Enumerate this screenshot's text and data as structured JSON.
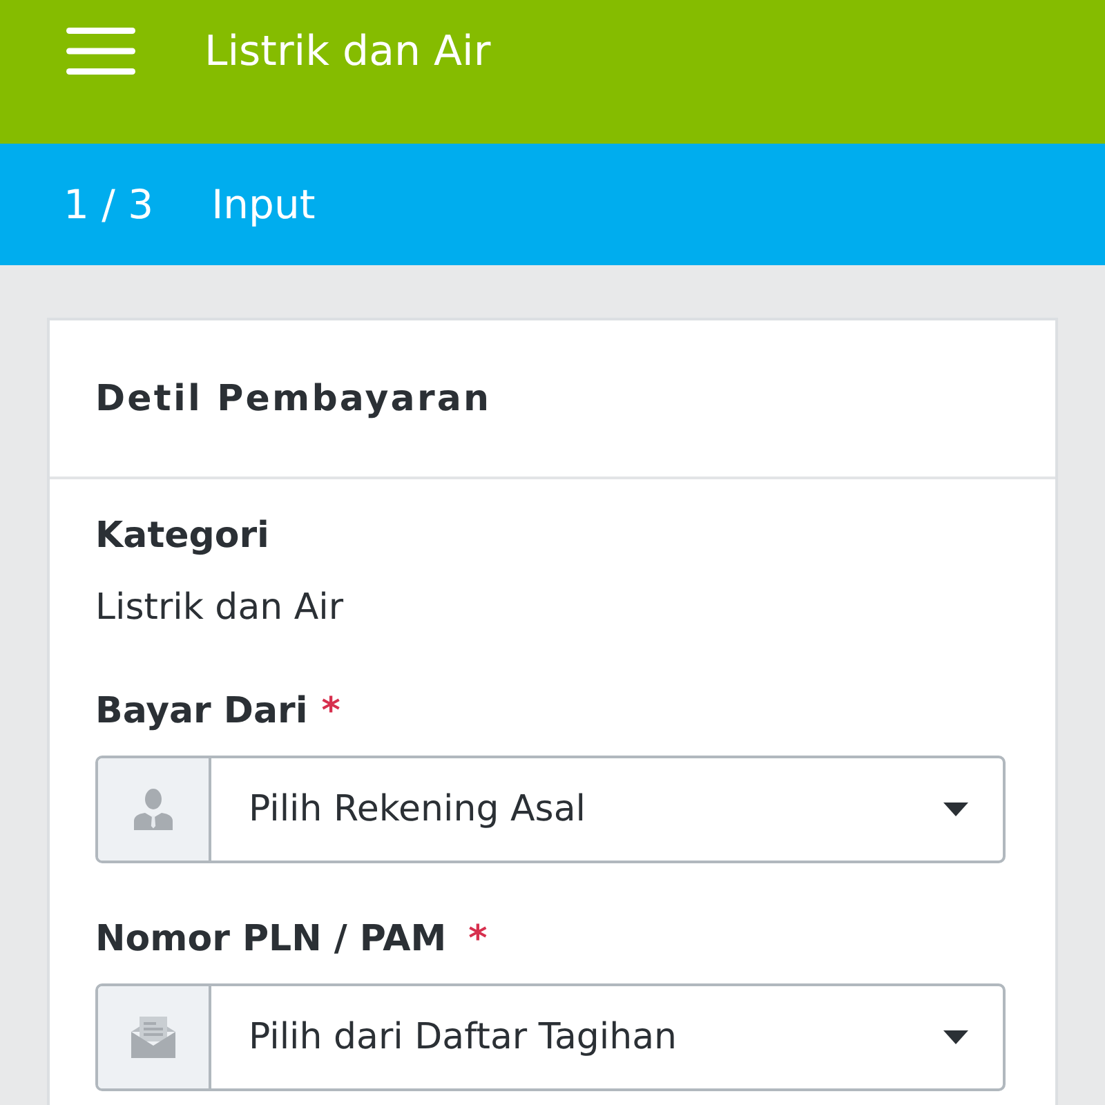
{
  "app_bar": {
    "title": "Listrik dan Air"
  },
  "step_bar": {
    "step": "1 / 3",
    "label": "Input"
  },
  "card": {
    "title": "Detil Pembayaran",
    "info": {
      "label": "Kategori",
      "value": "Listrik dan Air"
    },
    "fields": [
      {
        "kind": "account",
        "label": "Bayar Dari",
        "required_mark": "*",
        "prompt": "Pilih Rekening Asal"
      },
      {
        "kind": "bill",
        "label": "Nomor PLN / PAM",
        "required_mark": "*",
        "prompt": "Pilih dari Daftar Tagihan"
      }
    ]
  }
}
